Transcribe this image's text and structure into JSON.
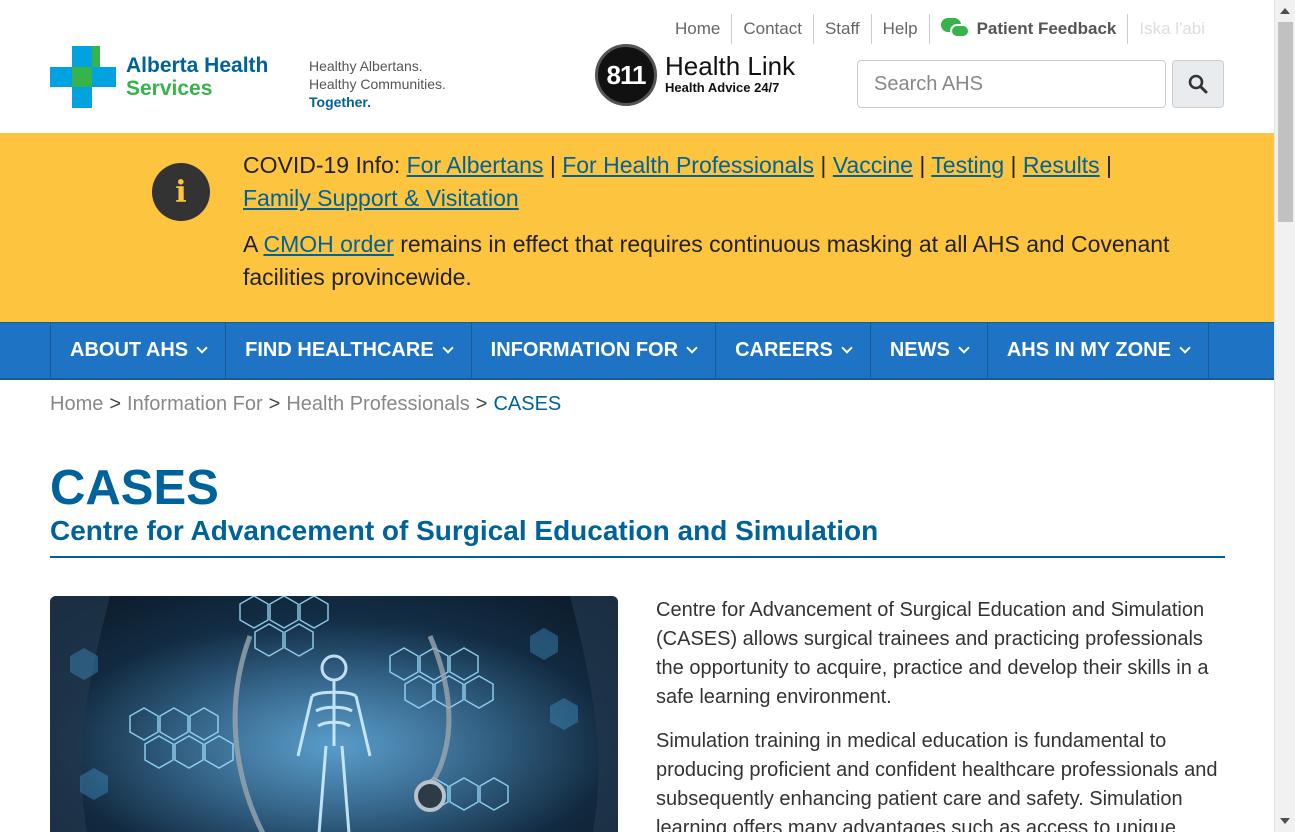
{
  "utility_nav": {
    "home": "Home",
    "contact": "Contact",
    "staff": "Staff",
    "help": "Help",
    "feedback": "Patient Feedback",
    "language": "Iska l'abi"
  },
  "brand": {
    "line1": "Alberta Health",
    "line2": "Services",
    "tagline1": "Healthy Albertans.",
    "tagline2": "Healthy Communities.",
    "tagline3": "Together."
  },
  "healthlink": {
    "number": "811",
    "title": "Health Link",
    "subtitle": "Health Advice 24/7"
  },
  "search": {
    "placeholder": "Search AHS"
  },
  "banner": {
    "prefix": "COVID-19 Info:",
    "links": [
      "For Albertans",
      "For Health Professionals",
      "Vaccine",
      "Testing",
      "Results",
      "Family Support & Visitation"
    ],
    "separator": "|",
    "notice_prefix": "A",
    "notice_link": "CMOH order",
    "notice_text": "remains in effect that requires continuous masking at all AHS and Covenant facilities provincewide."
  },
  "nav": {
    "items": [
      "ABOUT AHS",
      "FIND HEALTHCARE",
      "INFORMATION FOR",
      "CAREERS",
      "NEWS",
      "AHS IN MY ZONE"
    ]
  },
  "breadcrumb": {
    "items": [
      "Home",
      "Information For",
      "Health Professionals"
    ],
    "current": "CASES",
    "separator": ">"
  },
  "page": {
    "title": "CASES",
    "subtitle": "Centre for Advancement of Surgical Education and Simulation",
    "paragraph1": "Centre for Advancement of Surgical Education and Simulation (CASES) allows surgical trainees and practicing professionals the opportunity to acquire, practice and develop their skills in a safe learning environment.",
    "paragraph2": "Simulation training in medical education is fundamental to producing proficient and confident healthcare professionals and subsequently enhancing patient care and safety. Simulation learning offers many advantages such as access to unique"
  },
  "colors": {
    "brand_blue": "#00629b",
    "brand_green": "#36b34a",
    "banner_yellow": "#fdc43f",
    "nav_blue": "#1e73c4"
  }
}
